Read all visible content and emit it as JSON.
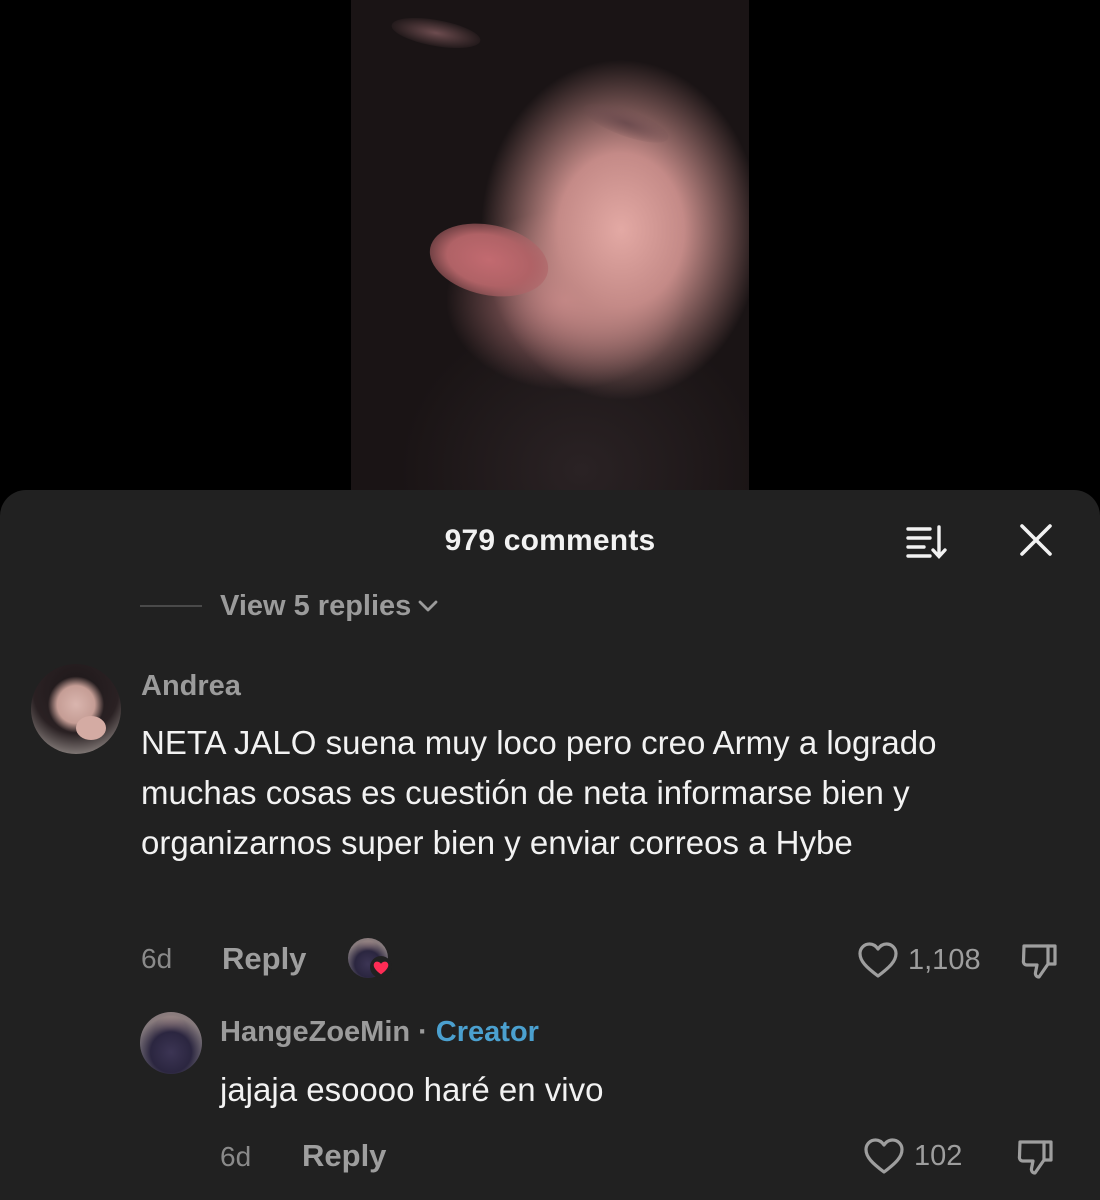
{
  "header": {
    "comment_count": "979 comments",
    "sort_icon": "sort-descending-icon",
    "close_icon": "close-icon"
  },
  "thread": {
    "view_replies": "View 5 replies",
    "chevron_icon": "chevron-down-icon"
  },
  "comments": [
    {
      "author": "Andrea",
      "text": "NETA JALO suena muy loco pero creo Army a logrado muchas cosas es cuestión de neta informarse bien y organizarnos super bien y enviar correos a Hybe",
      "time": "6d",
      "reply_label": "Reply",
      "likes": "1,108",
      "liked_by_creator": true
    },
    {
      "author": "HangeZoeMin",
      "separator": "·",
      "badge": "Creator",
      "text": "jajaja esoooo haré en vivo",
      "time": "6d",
      "reply_label": "Reply",
      "likes": "102"
    }
  ],
  "colors": {
    "sheet_bg": "#212121",
    "text_primary": "#f2f2f2",
    "text_secondary": "#9b9b9b",
    "creator_accent": "#4ba0cf",
    "heart_red": "#fe2c55"
  }
}
